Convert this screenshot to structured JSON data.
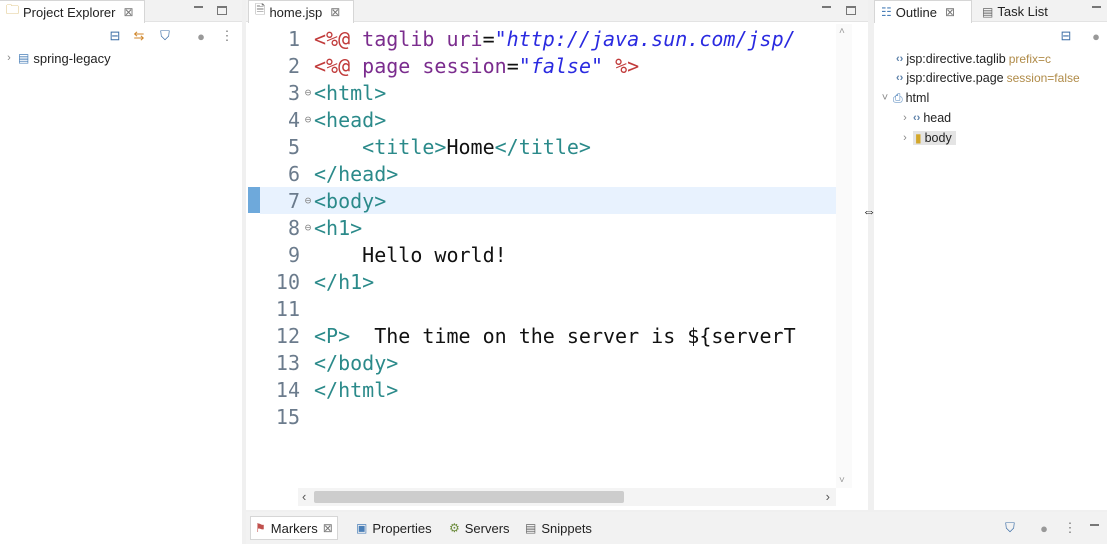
{
  "project_explorer": {
    "title": "Project Explorer",
    "close": "⊠",
    "items": [
      {
        "label": "spring-legacy"
      }
    ]
  },
  "editor": {
    "tab_title": "home.jsp",
    "close": "⊠",
    "lines": [
      {
        "n": "1",
        "fold": "",
        "segments": [
          {
            "t": "<%@ ",
            "c": "t-dir"
          },
          {
            "t": "taglib ",
            "c": "t-kw"
          },
          {
            "t": "uri",
            "c": "t-attr"
          },
          {
            "t": "=",
            "c": "t-txt"
          },
          {
            "t": "\"http://java.sun.com/jsp/",
            "c": "t-str"
          }
        ]
      },
      {
        "n": "2",
        "fold": "",
        "segments": [
          {
            "t": "<%@ ",
            "c": "t-dir"
          },
          {
            "t": "page ",
            "c": "t-kw"
          },
          {
            "t": "session",
            "c": "t-attr"
          },
          {
            "t": "=",
            "c": "t-txt"
          },
          {
            "t": "\"false\"",
            "c": "t-str"
          },
          {
            "t": " %>",
            "c": "t-pct"
          }
        ]
      },
      {
        "n": "3",
        "fold": "⊖",
        "segments": [
          {
            "t": "<html>",
            "c": "t-tag"
          }
        ]
      },
      {
        "n": "4",
        "fold": "⊖",
        "segments": [
          {
            "t": "<head>",
            "c": "t-tag"
          }
        ]
      },
      {
        "n": "5",
        "fold": "",
        "segments": [
          {
            "t": "    ",
            "c": "t-txt"
          },
          {
            "t": "<title>",
            "c": "t-tag"
          },
          {
            "t": "Home",
            "c": "t-txt"
          },
          {
            "t": "</title>",
            "c": "t-tag"
          }
        ]
      },
      {
        "n": "6",
        "fold": "",
        "segments": [
          {
            "t": "</head>",
            "c": "t-tag"
          }
        ]
      },
      {
        "n": "7",
        "fold": "⊖",
        "segments": [
          {
            "t": "<body>",
            "c": "t-tag"
          }
        ]
      },
      {
        "n": "8",
        "fold": "⊖",
        "segments": [
          {
            "t": "<h1>",
            "c": "t-tag"
          }
        ]
      },
      {
        "n": "9",
        "fold": "",
        "segments": [
          {
            "t": "    Hello world!",
            "c": "t-txt"
          }
        ]
      },
      {
        "n": "10",
        "fold": "",
        "segments": [
          {
            "t": "</h1>",
            "c": "t-tag"
          }
        ]
      },
      {
        "n": "11",
        "fold": "",
        "segments": []
      },
      {
        "n": "12",
        "fold": "",
        "segments": [
          {
            "t": "<P>",
            "c": "t-tag"
          },
          {
            "t": "  The time on the server is ${serverT",
            "c": "t-txt"
          }
        ]
      },
      {
        "n": "13",
        "fold": "",
        "segments": [
          {
            "t": "</body>",
            "c": "t-tag"
          }
        ]
      },
      {
        "n": "14",
        "fold": "",
        "segments": [
          {
            "t": "</html>",
            "c": "t-tag"
          }
        ]
      },
      {
        "n": "15",
        "fold": "",
        "segments": []
      }
    ],
    "highlighted_line": 7
  },
  "outline": {
    "tabs": [
      {
        "label": "Outline"
      },
      {
        "label": "Task List"
      }
    ],
    "close": "⊠",
    "items": [
      {
        "label": "jsp:directive.taglib",
        "sub": "prefix=c"
      },
      {
        "label": "jsp:directive.page",
        "sub": "session=false"
      },
      {
        "label": "html"
      },
      {
        "label": "head"
      },
      {
        "label": "body"
      }
    ]
  },
  "bottom": {
    "tabs": [
      {
        "label": "Markers",
        "close": "⊠"
      },
      {
        "label": "Properties"
      },
      {
        "label": "Servers"
      },
      {
        "label": "Snippets"
      }
    ]
  }
}
